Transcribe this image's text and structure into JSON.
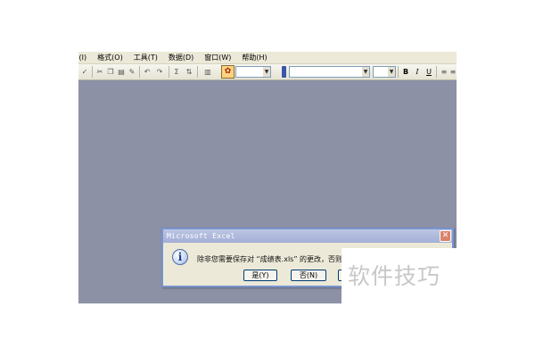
{
  "menubar": {
    "items": [
      " (I)",
      "格式(O)",
      "工具(T)",
      "数据(D)",
      "窗口(W)",
      "帮助(H)"
    ]
  },
  "toolbar": {
    "sum_glyph": "Σ",
    "bold": "B",
    "italic": "I",
    "underline": "U"
  },
  "dialog": {
    "title": "Microsoft Excel",
    "message": "除非您需要保存对 “成绩表.xls” 的更改，否则应以",
    "icon_glyph": "i",
    "close_glyph": "✕",
    "buttons": {
      "yes": "是(Y)",
      "no": "否(N)",
      "cancel": ""
    }
  },
  "watermark": {
    "text": "软件技巧"
  },
  "colors": {
    "workspace": "#8c91a5",
    "dialog_border": "#7894cf"
  }
}
